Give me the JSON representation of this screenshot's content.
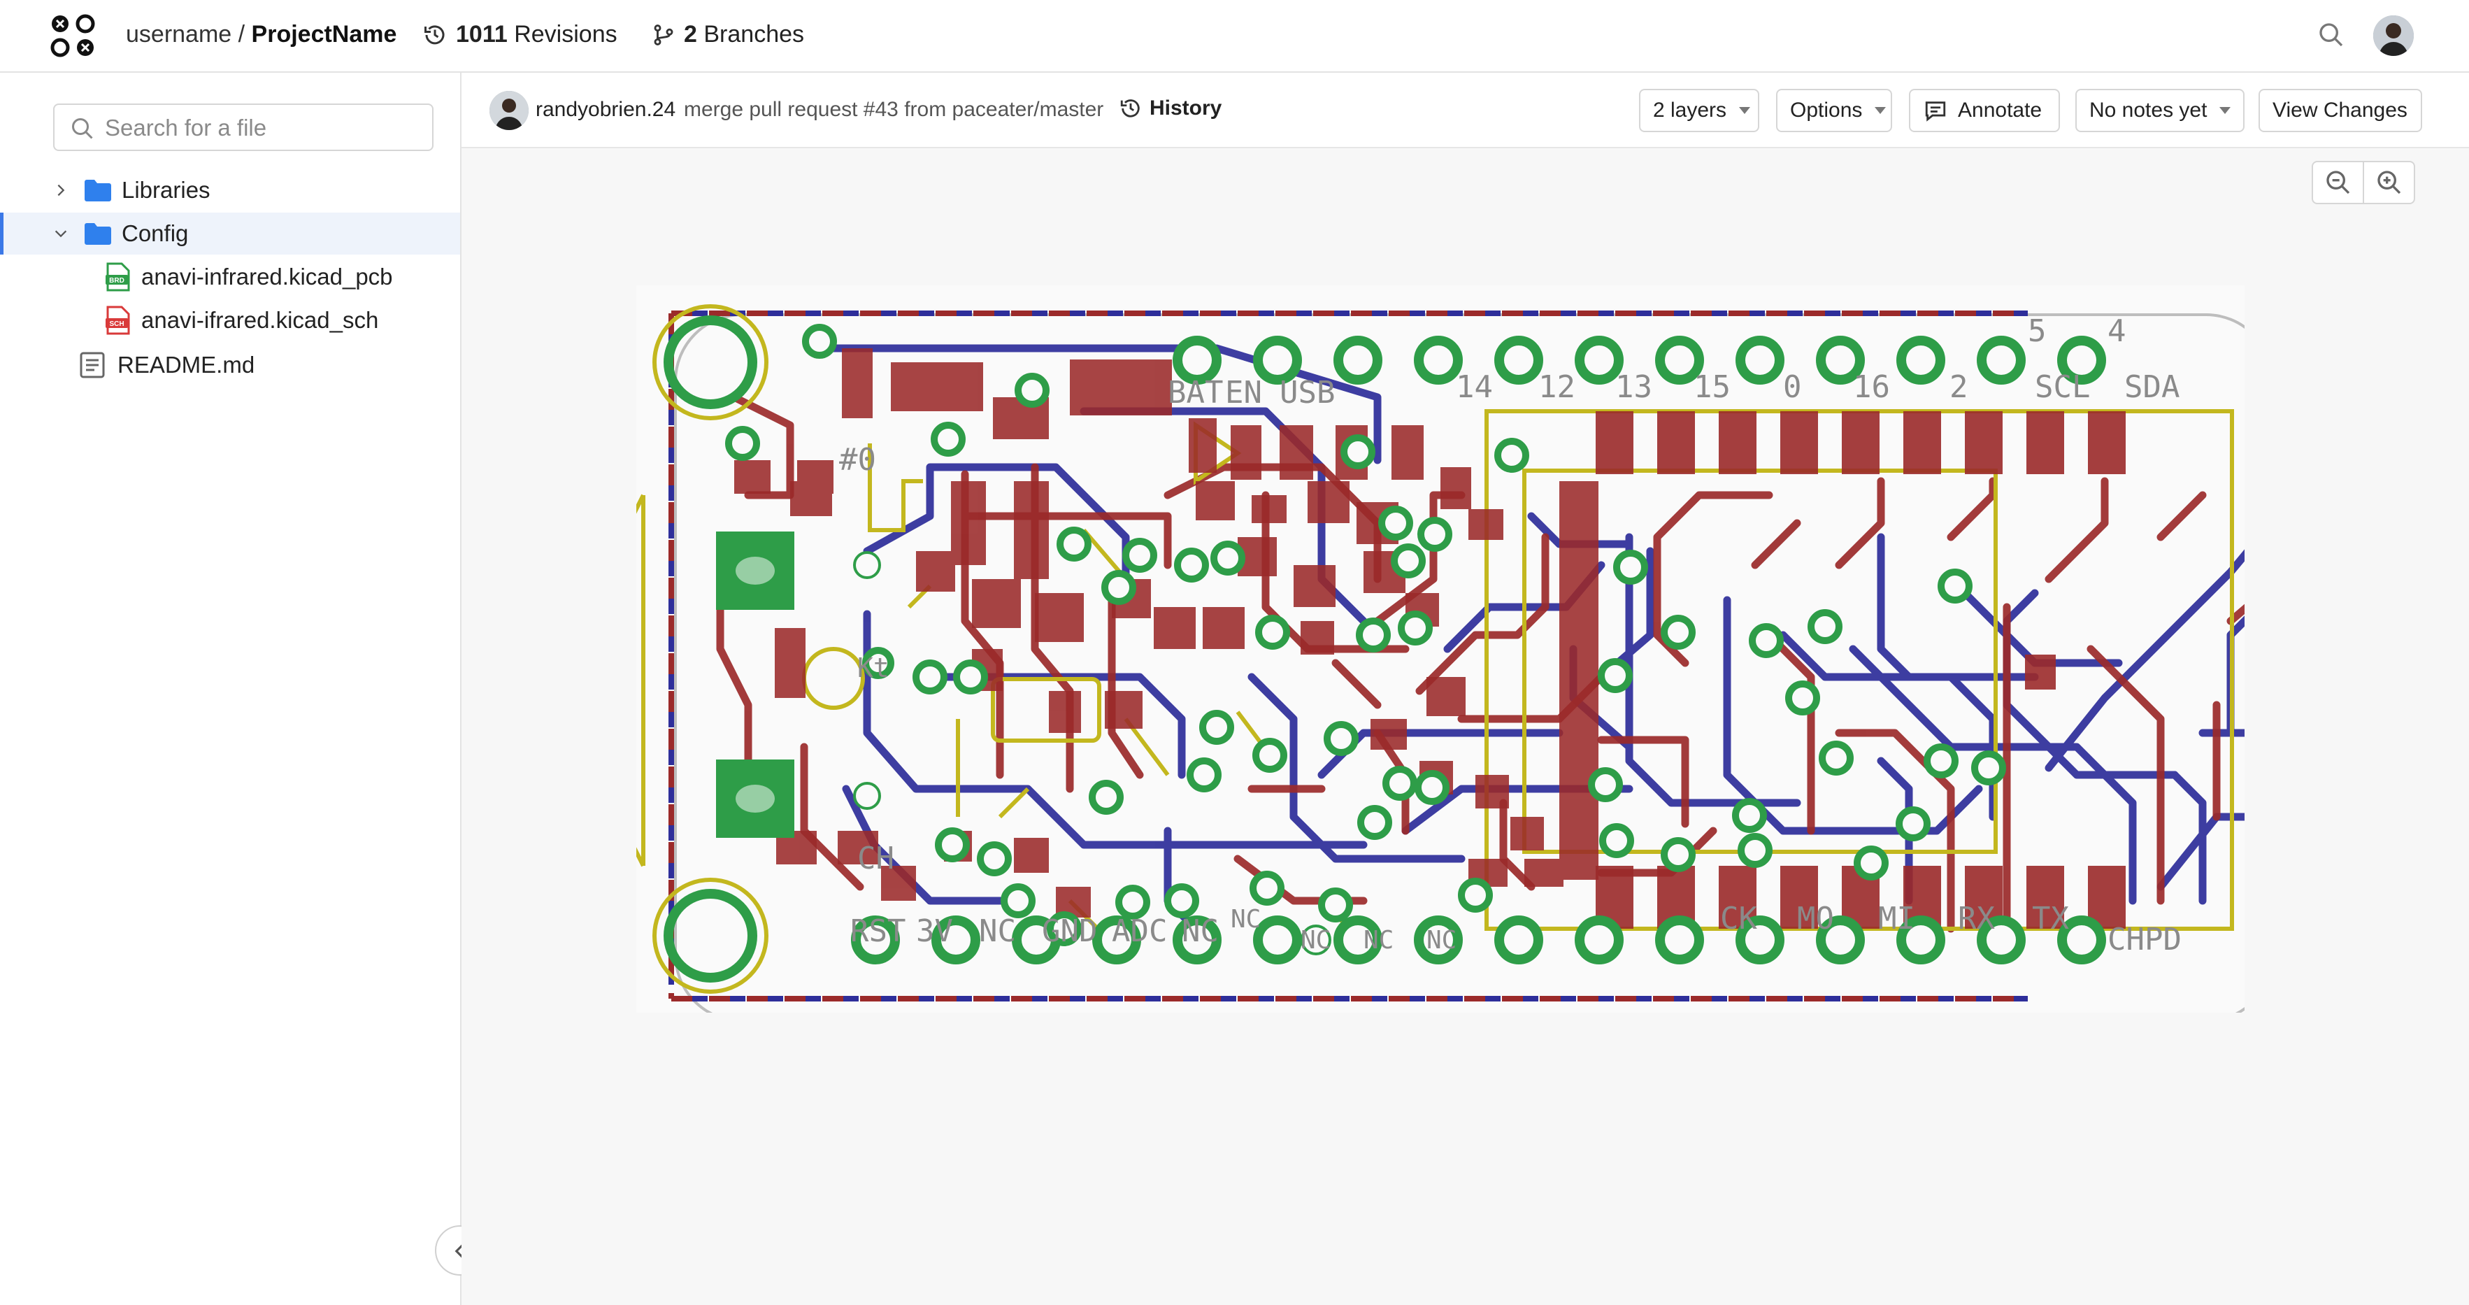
{
  "header": {
    "owner": "username",
    "separator": " / ",
    "project": "ProjectName",
    "revisions_count": "1011",
    "revisions_label": "Revisions",
    "branches_count": "2",
    "branches_label": "Branches"
  },
  "sidebar": {
    "search_placeholder": "Search for a file",
    "items": [
      {
        "label": "Libraries",
        "type": "folder",
        "expanded": false
      },
      {
        "label": "Config",
        "type": "folder",
        "expanded": true,
        "selected": true
      },
      {
        "label": "anavi-infrared.kicad_pcb",
        "type": "file",
        "badge": "BRD",
        "badge_color": "#2e9d48"
      },
      {
        "label": "anavi-ifrared.kicad_sch",
        "type": "file",
        "badge": "SCH",
        "badge_color": "#d93a3a"
      },
      {
        "label": "README.md",
        "type": "file"
      }
    ]
  },
  "commit": {
    "user": "randyobrien.24",
    "message": "merge pull request #43 from paceater/master",
    "history_label": "History"
  },
  "toolbar": {
    "layers_label": "2 layers",
    "options_label": "Options",
    "annotate_label": "Annotate",
    "notes_label": "No notes yet",
    "view_changes_label": "View Changes"
  },
  "pcb": {
    "colors": {
      "front_copper": "#9b2a2a",
      "back_copper": "#2e2e9a",
      "silkscreen": "#c3b71e",
      "pad": "#2e9d48",
      "outline": "#bbbbbb"
    },
    "top_labels": [
      "BAT",
      "EN",
      "USB",
      "14",
      "12",
      "13",
      "15",
      "0",
      "16",
      "2",
      "5",
      "4",
      "SCL",
      "SDA"
    ],
    "bottom_labels": [
      "RST",
      "3V",
      "NC",
      "GND",
      "ADC",
      "NC",
      "NC",
      "NC",
      "NC",
      "NC",
      "CK",
      "MO",
      "MI",
      "RX",
      "TX",
      "CHPD"
    ],
    "misc_labels": [
      "#0",
      "CH",
      "Kt"
    ]
  }
}
